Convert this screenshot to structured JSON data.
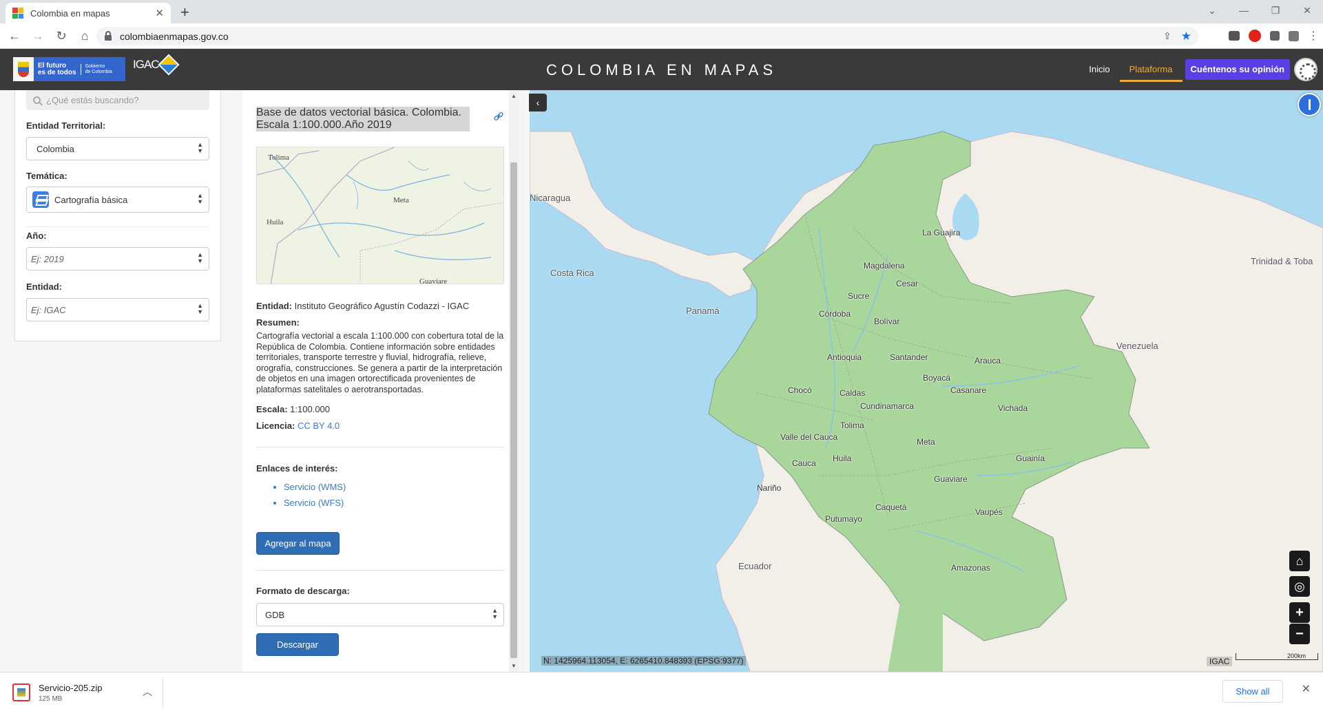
{
  "browser": {
    "tab_title": "Colombia en mapas",
    "url": "colombiaenmapas.gov.co",
    "new_tab_symbol": "+",
    "window_controls": [
      "⌄",
      "—",
      "❐",
      "✕"
    ]
  },
  "header": {
    "gov_logo_line1": "El futuro",
    "gov_logo_line2": "es de todos",
    "gov_logo_sub1": "Gobierno",
    "gov_logo_sub2": "de Colombia",
    "igac_logo": "IGAC",
    "site_title": "COLOMBIA EN MAPAS",
    "nav": [
      {
        "label": "Inicio"
      },
      {
        "label": "Plataforma"
      }
    ],
    "feedback_button": "Cuéntenos su opinión"
  },
  "filters": {
    "search_placeholder": "¿Qué estás buscando?",
    "territorial_label": "Entidad Territorial:",
    "territorial_value": "Colombia",
    "theme_label": "Temática:",
    "theme_value": "Cartografía básica",
    "year_label": "Año:",
    "year_placeholder": "Ej: 2019",
    "entity_label": "Entidad:",
    "entity_placeholder": "Ej: IGAC"
  },
  "detail": {
    "title": "Base de datos vectorial básica. Colombia. Escala 1:100.000.Año 2019",
    "thumb_labels": [
      "Tolima",
      "Meta",
      "Huila",
      "Guaviare"
    ],
    "entity_label": "Entidad:",
    "entity_value": "Instituto Geográfico Agustín Codazzi - IGAC",
    "summary_label": "Resumen:",
    "summary_text": "Cartografía vectorial a escala 1:100.000 con cobertura total de la República de Colombia. Contiene información sobre entidades territoriales, transporte terrestre y fluvial, hidrografía, relieve, orografía, construcciones. Se genera a partir de la interpretación de objetos en una imagen ortorectificada provenientes de plataformas satelitales o aerotransportadas.",
    "scale_label": "Escala:",
    "scale_value": "1:100.000",
    "license_label": "Licencia:",
    "license_value": "CC BY 4.0",
    "links_label": "Enlaces de interés:",
    "links": [
      "Servicio (WMS)",
      "Servicio (WFS)"
    ],
    "add_button": "Agregar al mapa",
    "format_label": "Formato de descarga:",
    "format_value": "GDB",
    "download_button": "Descargar"
  },
  "map": {
    "labels": [
      {
        "text": "Nicaragua",
        "kind": "country"
      },
      {
        "text": "Costa Rica",
        "kind": "country"
      },
      {
        "text": "Panamá",
        "kind": "country"
      },
      {
        "text": "Venezuela",
        "kind": "country"
      },
      {
        "text": "Ecuador",
        "kind": "country"
      },
      {
        "text": "Trinidad & Toba",
        "kind": "country"
      },
      {
        "text": "La Guajira",
        "kind": "dept"
      },
      {
        "text": "Magdalena",
        "kind": "dept"
      },
      {
        "text": "Cesar",
        "kind": "dept"
      },
      {
        "text": "Sucre",
        "kind": "dept"
      },
      {
        "text": "Córdoba",
        "kind": "dept"
      },
      {
        "text": "Bolívar",
        "kind": "dept"
      },
      {
        "text": "Antioquia",
        "kind": "dept"
      },
      {
        "text": "Santander",
        "kind": "dept"
      },
      {
        "text": "Arauca",
        "kind": "dept"
      },
      {
        "text": "Boyacá",
        "kind": "dept"
      },
      {
        "text": "Casanare",
        "kind": "dept"
      },
      {
        "text": "Chocó",
        "kind": "dept"
      },
      {
        "text": "Caldas",
        "kind": "dept"
      },
      {
        "text": "Cundinamarca",
        "kind": "dept"
      },
      {
        "text": "Vichada",
        "kind": "dept"
      },
      {
        "text": "Tolima",
        "kind": "dept"
      },
      {
        "text": "Valle del Cauca",
        "kind": "dept"
      },
      {
        "text": "Meta",
        "kind": "dept"
      },
      {
        "text": "Huila",
        "kind": "dept"
      },
      {
        "text": "Cauca",
        "kind": "dept"
      },
      {
        "text": "Guainía",
        "kind": "dept"
      },
      {
        "text": "Nariño",
        "kind": "dept"
      },
      {
        "text": "Guaviare",
        "kind": "dept"
      },
      {
        "text": "Caquetá",
        "kind": "dept"
      },
      {
        "text": "Vaupés",
        "kind": "dept"
      },
      {
        "text": "Putumayo",
        "kind": "dept"
      },
      {
        "text": "Amazonas",
        "kind": "dept"
      }
    ],
    "coordinates": "N: 1425964.113054, E: 6265410.848393 (EPSG:9377)",
    "attribution": "IGAC",
    "scale_label": "200km",
    "collapse_symbol": "‹",
    "controls": [
      {
        "name": "home-button",
        "symbol": "⌂"
      },
      {
        "name": "locate-button",
        "symbol": "◎"
      },
      {
        "name": "zoom-in-button",
        "symbol": "+"
      },
      {
        "name": "zoom-out-button",
        "symbol": "−"
      }
    ]
  },
  "downloads": {
    "file_name": "Servicio-205.zip",
    "file_size": "125 MB",
    "show_all": "Show all"
  },
  "colors": {
    "header_bg": "#3a3a3a",
    "accent_orange": "#f2a93b",
    "feedback_purple": "#5b3fe6",
    "primary_button": "#2f6db5",
    "land": "#f2efe9",
    "colombia_vegetation": "#a9d69a",
    "water": "#aadaf2"
  }
}
